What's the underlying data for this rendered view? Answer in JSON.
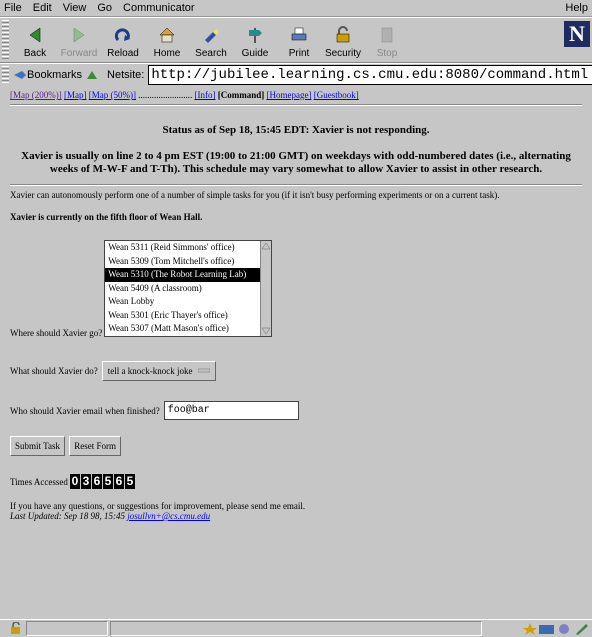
{
  "menu": [
    "File",
    "Edit",
    "View",
    "Go",
    "Communicator"
  ],
  "menu_help": "Help",
  "toolbar": [
    "Back",
    "Forward",
    "Reload",
    "Home",
    "Search",
    "Guide",
    "Print",
    "Security",
    "Stop"
  ],
  "location": {
    "bookmarks_label": "Bookmarks",
    "netsite_label": "Netsite:",
    "url": "http://jubilee.learning.cs.cmu.edu:8080/command.html"
  },
  "nav": {
    "map200": "[Map (200%)]",
    "map": "[Map]",
    "map50": "[Map (50%)]",
    "dots": "........................",
    "info": "[Info]",
    "command": "[Command]",
    "homepage": "[Homepage]",
    "guestbook": "[Guestbook]"
  },
  "status_line": "Status as of Sep 18, 15:45 EDT: Xavier is not responding.",
  "schedule": "Xavier is usually on line 2 to 4 pm EST (19:00 to 21:00 GMT) on weekdays with odd-numbered dates (i.e., alternating weeks of M-W-F and T-Th). This schedule may vary somewhat to allow Xavier to assist in other research.",
  "intro": "Xavier can autonomously perform one of a number of simple tasks for you (if it isn't busy performing experiments or on a current task).",
  "location_line": "Xavier is currently on the fifth floor of Wean Hall.",
  "where_label": "Where should Xavier go?",
  "destinations": [
    "Wean 5311 (Reid Simmons' office)",
    "Wean 5309 (Tom Mitchell's office)",
    "Wean 5310 (The Robot Learning Lab)",
    "Wean 5409 (A classroom)",
    "Wean Lobby",
    "Wean 5301 (Eric Thayer's office)",
    "Wean 5307 (Matt Mason's office)"
  ],
  "destination_selected": "Wean 5310 (The Robot Learning Lab)",
  "what_label": "What should Xavier do?",
  "task_selected": "tell a knock-knock joke",
  "email_label": "Who should Xavier email when finished?",
  "email_value": "foo@bar",
  "submit_label": "Submit Task",
  "reset_label": "Reset Form",
  "times_label": "Times Accessed",
  "counter": [
    "0",
    "3",
    "6",
    "5",
    "6",
    "5"
  ],
  "footer_line": "If you have any questions, or suggestions for improvement, please send me email.",
  "last_updated": "Last Updated: Sep 18 98, 15:45",
  "email_link": "josullvn+@cs.cmu.edu"
}
